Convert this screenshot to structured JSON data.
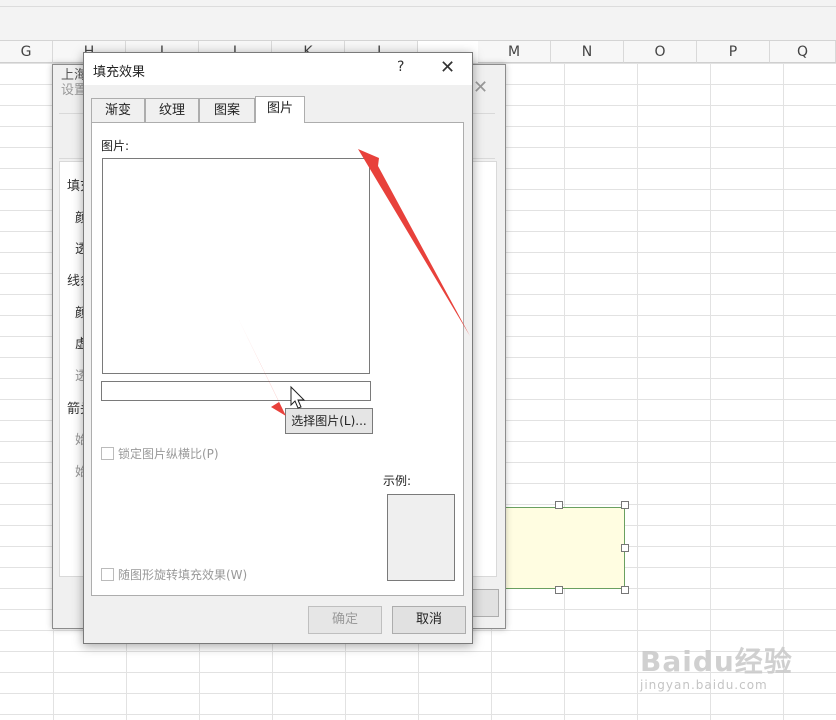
{
  "sheet": {
    "columns": [
      "G",
      "H",
      "I",
      "J",
      "K",
      "L",
      "M",
      "N",
      "O",
      "P",
      "Q"
    ]
  },
  "back_dialog": {
    "title": "设置",
    "title_behind": "上海",
    "close_glyph": "✕",
    "labels": [
      "填充",
      "颜",
      "透",
      "线条",
      "颜",
      "虚",
      "透",
      "箭头",
      "始",
      "始"
    ]
  },
  "dialog": {
    "title": "填充效果",
    "help_glyph": "?",
    "close_glyph": "✕",
    "tabs": [
      {
        "label": "渐变",
        "active": false
      },
      {
        "label": "纹理",
        "active": false
      },
      {
        "label": "图案",
        "active": false
      },
      {
        "label": "图片",
        "active": true
      }
    ],
    "picture_label": "图片:",
    "path_value": "",
    "choose_button": "选择图片(L)...",
    "lock_aspect": {
      "label": "锁定图片纵横比(P)",
      "checked": false,
      "enabled": false
    },
    "rotate_with_shape": {
      "label": "随图形旋转填充效果(W)",
      "checked": false,
      "enabled": false
    },
    "sample_label": "示例:",
    "ok_button": "确定",
    "cancel_button": "取消"
  },
  "overlay": {
    "arrow_color": "#e8413b"
  },
  "watermark": {
    "logo": "Baidu经验",
    "url": "jingyan.baidu.com"
  }
}
